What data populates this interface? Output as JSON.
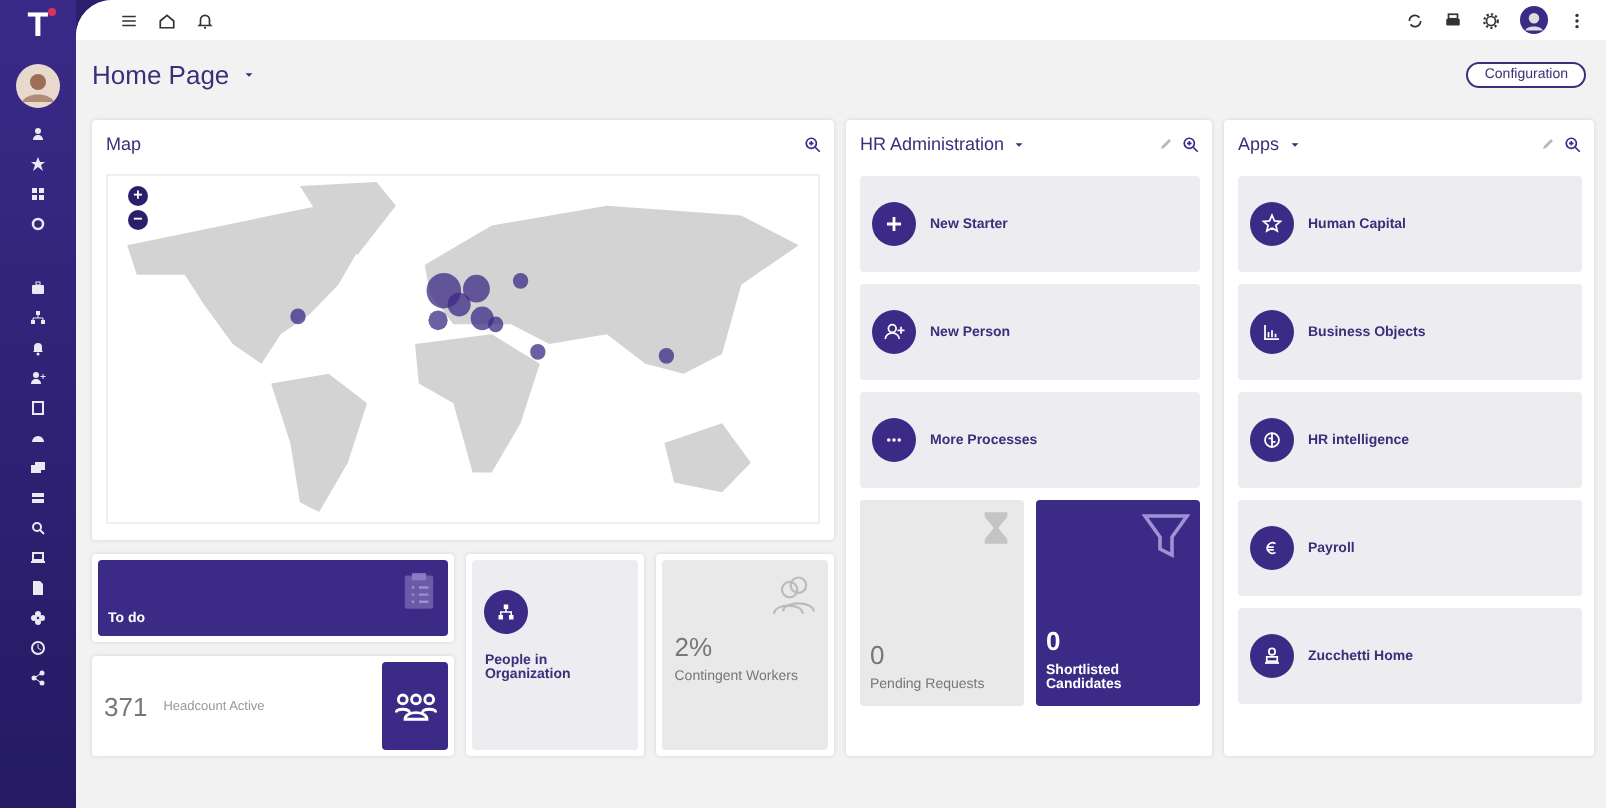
{
  "sidebar": {
    "logo": "T"
  },
  "page": {
    "title": "Home Page",
    "config_button": "Configuration"
  },
  "map": {
    "title": "Map",
    "zoom_in": "+",
    "zoom_out": "−"
  },
  "hr": {
    "title": "HR Administration",
    "actions": [
      {
        "label": "New Starter"
      },
      {
        "label": "New Person"
      },
      {
        "label": "More Processes"
      }
    ],
    "tiles": [
      {
        "value": "0",
        "label": "Pending Requests",
        "kind": "neutral"
      },
      {
        "value": "0",
        "label": "Shortlisted Candidates",
        "kind": "highlight"
      }
    ]
  },
  "apps": {
    "title": "Apps",
    "items": [
      {
        "label": "Human Capital"
      },
      {
        "label": "Business Objects"
      },
      {
        "label": "HR intelligence"
      },
      {
        "label": "Payroll"
      },
      {
        "label": "Zucchetti Home"
      }
    ]
  },
  "widgets": {
    "todo": {
      "label": "To do"
    },
    "headcount": {
      "value": "371",
      "label": "Headcount Active"
    },
    "people": {
      "label": "People in Organization"
    },
    "contingent": {
      "value": "2%",
      "label": "Contingent Workers"
    }
  }
}
